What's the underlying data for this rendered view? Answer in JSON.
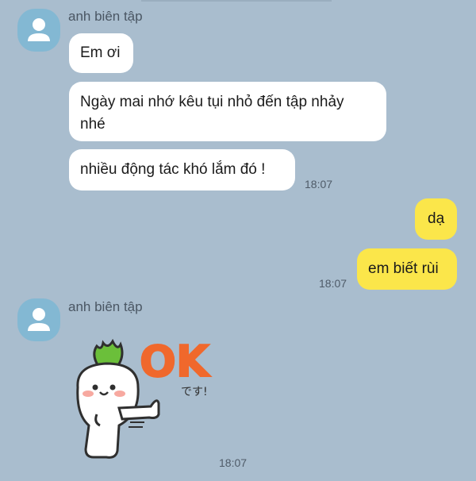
{
  "chat": {
    "group1": {
      "sender": "anh biên tập",
      "messages": [
        {
          "text": "Em ơi"
        },
        {
          "text_line1": "Ngày mai nhớ kêu tụi nhỏ đến tập nhảy",
          "text_line2": "nhé"
        },
        {
          "text": "nhiều động tác khó lắm đó !"
        }
      ],
      "time": "18:07"
    },
    "outgoing": {
      "messages": [
        {
          "text": "dạ"
        },
        {
          "text": "em biết rùi"
        }
      ],
      "time": "18:07"
    },
    "group2": {
      "sender": "anh biên tập",
      "sticker": {
        "text_ok": "OK",
        "text_desu": "です!",
        "name": "radish-ok-sticker"
      },
      "time": "18:07"
    }
  },
  "colors": {
    "background": "#a9bdce",
    "incoming_bubble": "#ffffff",
    "outgoing_bubble": "#fbe64a",
    "avatar": "#83b8d3"
  }
}
